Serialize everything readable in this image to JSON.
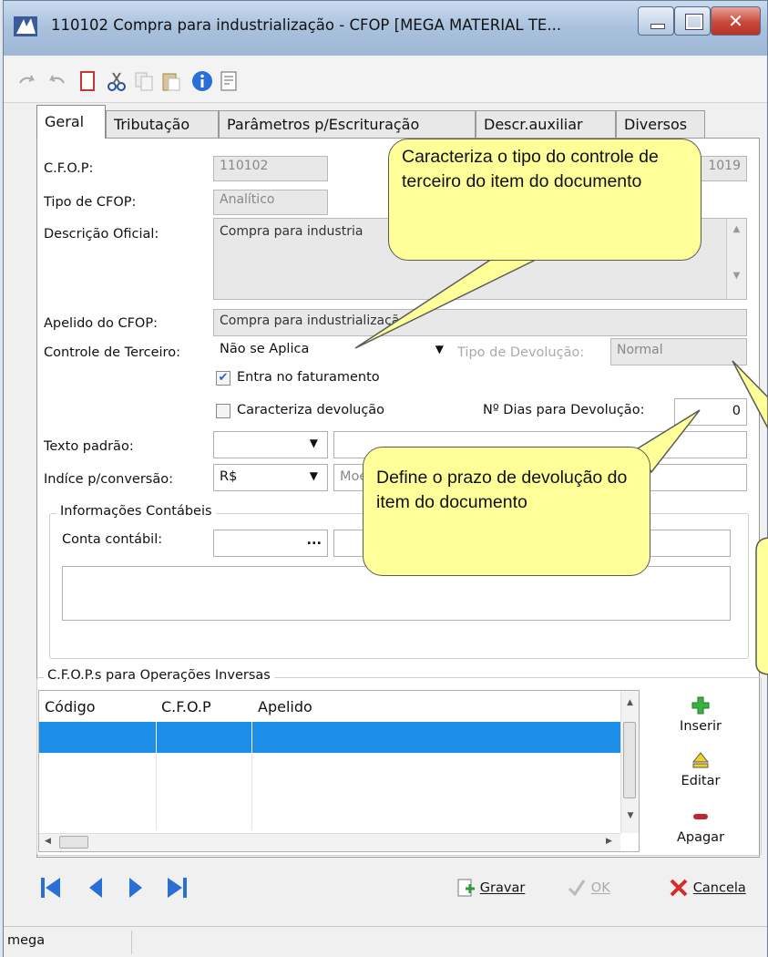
{
  "window": {
    "title": "110102 Compra para industrialização - CFOP [MEGA MATERIAL TE..."
  },
  "tabs": [
    "Geral",
    "Tributação",
    "Parâmetros p/Escrituração",
    "Descr.auxiliar",
    "Diversos"
  ],
  "form": {
    "cfop_label": "C.F.O.P:",
    "cfop_value": "110102",
    "cfop_extra": "1019",
    "tipo_label": "Tipo de CFOP:",
    "tipo_value": "Analítico",
    "descricao_label": "Descrição Oficial:",
    "descricao_value": "Compra para industria",
    "apelido_label": "Apelido do CFOP:",
    "apelido_value": "Compra para industrialização",
    "controle_label": "Controle de Terceiro:",
    "controle_value": "Não se Aplica",
    "tipo_devolucao_label": "Tipo de Devolução:",
    "tipo_devolucao_value": "Normal",
    "entra_faturamento": "Entra no faturamento",
    "caracteriza_devolucao": "Caracteriza devolução",
    "dias_devolucao_label": "Nº Dias para Devolução:",
    "dias_devolucao_value": "0",
    "texto_padrao_label": "Texto padrão:",
    "indice_label": "Indíce p/conversão:",
    "indice_value": "R$",
    "moeda_placeholder": "Moe"
  },
  "contabeis": {
    "title": "Informações Contábeis",
    "conta_label": "Conta contábil:",
    "ellipsis": "..."
  },
  "inversas": {
    "title": "C.F.O.P.s para Operações Inversas",
    "columns": [
      "Código",
      "C.F.O.P",
      "Apelido"
    ],
    "buttons": [
      "Inserir",
      "Editar",
      "Apagar"
    ]
  },
  "footer": {
    "gravar": "Gravar",
    "ok": "OK",
    "cancela": "Cancela"
  },
  "status": {
    "user": "mega"
  },
  "callouts": {
    "controle": "Caracteriza o tipo do controle de terceiro do item do documento",
    "prazo": "Define o prazo de devolução do item do documento"
  }
}
